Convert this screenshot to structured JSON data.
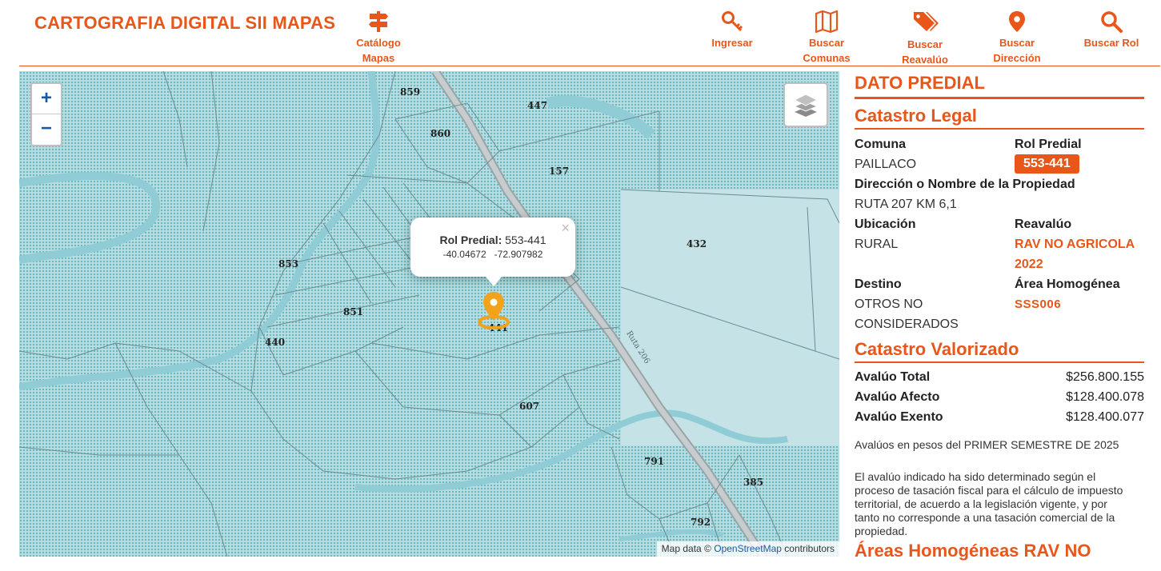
{
  "header": {
    "title": "CARTOGRAFIA DIGITAL SII MAPAS",
    "nav": [
      {
        "line1": "Catálogo",
        "line2": "Mapas"
      },
      {
        "line1": "Ingresar",
        "line2": ""
      },
      {
        "line1": "Buscar",
        "line2": "Comunas"
      },
      {
        "line1": "Buscar",
        "line2": "Reavalúo"
      },
      {
        "line1": "Buscar",
        "line2": "Dirección"
      },
      {
        "line1": "Buscar Rol",
        "line2": ""
      }
    ]
  },
  "map": {
    "zoom_in": "+",
    "zoom_out": "−",
    "lots": [
      "859",
      "447",
      "860",
      "157",
      "432",
      "853",
      "851",
      "440",
      "441",
      "607",
      "791",
      "385",
      "792"
    ],
    "road_label": "Ruta 206",
    "popup": {
      "close": "×",
      "label": "Rol Predial:",
      "value": "553-441",
      "lat": "-40.04672",
      "lon": "-72.907982"
    },
    "attribution": {
      "prefix": "Map data ©",
      "link": "OpenStreetMap",
      "suffix": "contributors"
    }
  },
  "panel": {
    "title": "DATO PREDIAL",
    "legal_title": "Catastro Legal",
    "comuna_label": "Comuna",
    "comuna_value": "PAILLACO",
    "rol_label": "Rol Predial",
    "rol_value": "553-441",
    "direccion_label": "Dirección o Nombre de la Propiedad",
    "direccion_value": "RUTA 207 KM 6,1",
    "ubicacion_label": "Ubicación",
    "ubicacion_value": "RURAL",
    "reavaluo_label": "Reavalúo",
    "reavaluo_line1": "RAV NO AGRICOLA",
    "reavaluo_line2": "2022",
    "destino_label": "Destino",
    "destino_line1": "OTROS NO",
    "destino_line2": "CONSIDERADOS",
    "area_label": "Área Homogénea",
    "area_value": "SSS006",
    "valorizado_title": "Catastro Valorizado",
    "avaluo_total_label": "Avalúo Total",
    "avaluo_total_value": "$256.800.155",
    "avaluo_afecto_label": "Avalúo Afecto",
    "avaluo_afecto_value": "$128.400.078",
    "avaluo_exento_label": "Avalúo Exento",
    "avaluo_exento_value": "$128.400.077",
    "semestre_note": "Avalúos en pesos del PRIMER SEMESTRE DE 2025",
    "disclaimer": "El avalúo indicado ha sido determinado según el proceso de tasación fiscal para el cálculo de impuesto territorial, de acuerdo a la legislación vigente, y por tanto no corresponde a una tasación comercial de la propiedad.",
    "next_section": "Áreas Homogéneas RAV NO"
  },
  "colors": {
    "accent": "#e8561a",
    "map_water": "#a8d5dc",
    "link": "#1a5aa3"
  }
}
